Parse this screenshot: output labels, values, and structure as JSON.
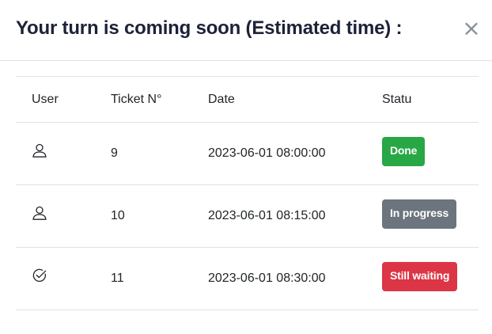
{
  "modal": {
    "title": "Your turn is coming soon (Estimated time) :",
    "close_label": "×"
  },
  "table": {
    "headers": [
      "User",
      "Ticket N°",
      "Date",
      "Statu"
    ],
    "rows": [
      {
        "user_icon": "user-icon",
        "ticket": "9",
        "date": "2023-06-01 08:00:00",
        "status": "Done",
        "status_color": "#28a745"
      },
      {
        "user_icon": "user-icon",
        "ticket": "10",
        "date": "2023-06-01 08:15:00",
        "status": "In progress",
        "status_color": "#6c757d"
      },
      {
        "user_icon": "check-circle-icon",
        "ticket": "11",
        "date": "2023-06-01 08:30:00",
        "status": "Still waiting",
        "status_color": "#dc3545"
      }
    ]
  }
}
